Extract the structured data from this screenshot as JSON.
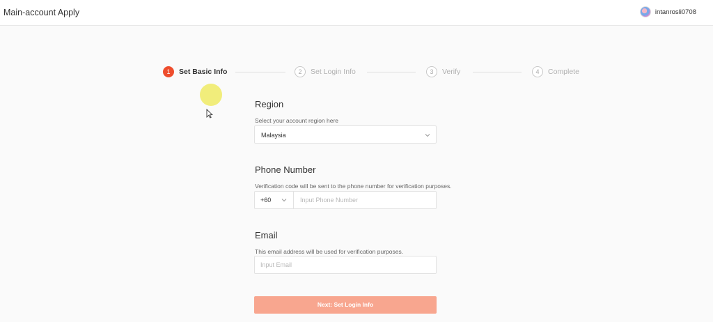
{
  "header": {
    "title": "Main-account Apply",
    "username": "intanrosli0708"
  },
  "steps": [
    {
      "num": "1",
      "label": "Set Basic Info",
      "active": true
    },
    {
      "num": "2",
      "label": "Set Login Info",
      "active": false
    },
    {
      "num": "3",
      "label": "Verify",
      "active": false
    },
    {
      "num": "4",
      "label": "Complete",
      "active": false
    }
  ],
  "form": {
    "region": {
      "title": "Region",
      "description": "Select your account region here",
      "value": "Malaysia"
    },
    "phone": {
      "title": "Phone Number",
      "description": "Verification code will be sent to the phone number for verification purposes.",
      "country_code": "+60",
      "placeholder": "Input Phone Number"
    },
    "email": {
      "title": "Email",
      "description": "This email address will be used for verification purposes.",
      "placeholder": "Input Email"
    },
    "next_label": "Next: Set Login Info"
  },
  "colors": {
    "accent": "#ee4d2d",
    "button_disabled": "#f8a68f"
  }
}
